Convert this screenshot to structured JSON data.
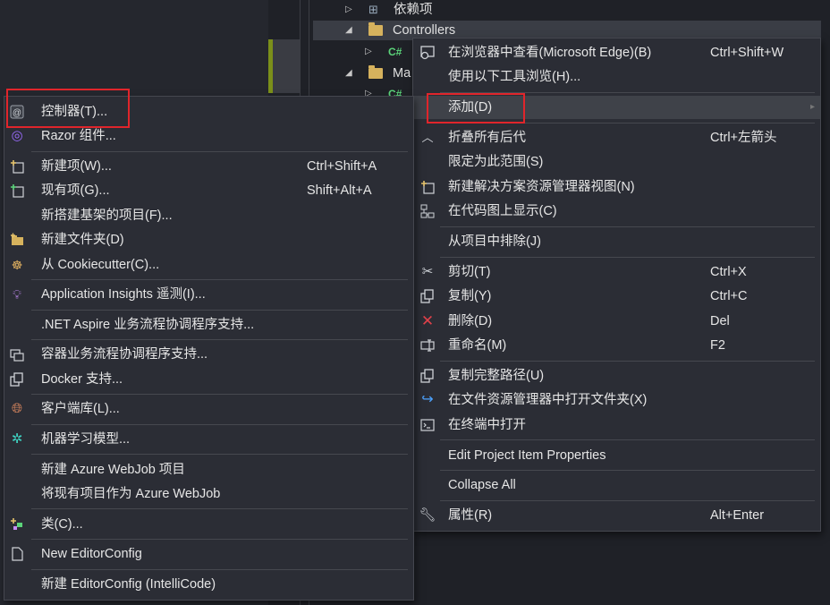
{
  "tree": {
    "rows": [
      {
        "label": "依赖项"
      },
      {
        "label": "Controllers"
      },
      {
        "label": "C#"
      },
      {
        "label": "Ma"
      },
      {
        "label": "C#"
      }
    ]
  },
  "context_menu": {
    "items": [
      {
        "label": "在浏览器中查看(Microsoft Edge)(B)",
        "shortcut": "Ctrl+Shift+W"
      },
      {
        "label": "使用以下工具浏览(H)..."
      },
      {
        "label": "添加(D)"
      },
      {
        "label": "折叠所有后代",
        "shortcut": "Ctrl+左箭头"
      },
      {
        "label": "限定为此范围(S)"
      },
      {
        "label": "新建解决方案资源管理器视图(N)"
      },
      {
        "label": "在代码图上显示(C)"
      },
      {
        "label": "从项目中排除(J)"
      },
      {
        "label": "剪切(T)",
        "shortcut": "Ctrl+X"
      },
      {
        "label": "复制(Y)",
        "shortcut": "Ctrl+C"
      },
      {
        "label": "删除(D)",
        "shortcut": "Del"
      },
      {
        "label": "重命名(M)",
        "shortcut": "F2"
      },
      {
        "label": "复制完整路径(U)"
      },
      {
        "label": "在文件资源管理器中打开文件夹(X)"
      },
      {
        "label": "在终端中打开"
      },
      {
        "label": "Edit Project Item Properties"
      },
      {
        "label": "Collapse All"
      },
      {
        "label": "属性(R)",
        "shortcut": "Alt+Enter"
      }
    ]
  },
  "add_submenu": {
    "items": [
      {
        "label": "控制器(T)..."
      },
      {
        "label": "Razor 组件..."
      },
      {
        "label": "新建项(W)...",
        "shortcut": "Ctrl+Shift+A"
      },
      {
        "label": "现有项(G)...",
        "shortcut": "Shift+Alt+A"
      },
      {
        "label": "新搭建基架的项目(F)..."
      },
      {
        "label": "新建文件夹(D)"
      },
      {
        "label": "从 Cookiecutter(C)..."
      },
      {
        "label": "Application Insights 遥测(I)..."
      },
      {
        "label": ".NET Aspire 业务流程协调程序支持..."
      },
      {
        "label": "容器业务流程协调程序支持..."
      },
      {
        "label": "Docker 支持..."
      },
      {
        "label": "客户端库(L)..."
      },
      {
        "label": "机器学习模型..."
      },
      {
        "label": "新建 Azure WebJob 项目"
      },
      {
        "label": "将现有项目作为 Azure WebJob"
      },
      {
        "label": "类(C)..."
      },
      {
        "label": "New EditorConfig"
      },
      {
        "label": "新建 EditorConfig (IntelliCode)"
      }
    ]
  },
  "colors": {
    "accent_highlight": "#e0252b",
    "menu_bg": "#2b2d35"
  }
}
